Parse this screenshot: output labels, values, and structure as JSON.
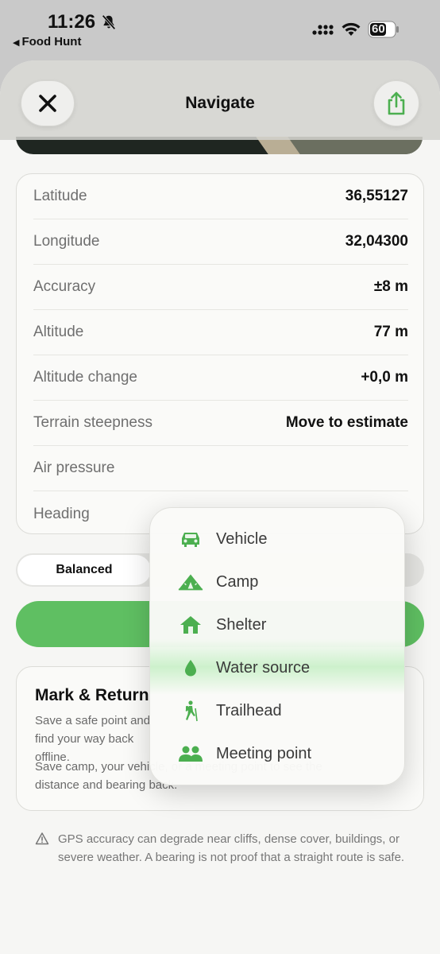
{
  "status_bar": {
    "time": "11:26",
    "back_app": "Food Hunt",
    "battery": "60"
  },
  "header": {
    "title": "Navigate"
  },
  "info": {
    "rows": [
      {
        "label": "Latitude",
        "value": "36,55127"
      },
      {
        "label": "Longitude",
        "value": "32,04300"
      },
      {
        "label": "Accuracy",
        "value": "±8 m"
      },
      {
        "label": "Altitude",
        "value": "77 m"
      },
      {
        "label": "Altitude change",
        "value": "+0,0 m"
      },
      {
        "label": "Terrain steepness",
        "value": "Move to estimate"
      },
      {
        "label": "Air pressure",
        "value": ""
      },
      {
        "label": "Heading",
        "value": ""
      }
    ]
  },
  "segment": {
    "selected_label": "Balanced"
  },
  "mark_card": {
    "title": "Mark & Return",
    "subtitle": "Save a safe point and find your way back offline.",
    "body": "Save camp, your vehicle, or a meeting point to see the distance and bearing back."
  },
  "warning": {
    "text": "GPS accuracy can degrade near cliffs, dense cover, buildings, or severe weather. A bearing is not proof that a straight route is safe."
  },
  "menu": {
    "items": [
      {
        "label": "Vehicle",
        "icon": "car-icon"
      },
      {
        "label": "Camp",
        "icon": "tent-icon"
      },
      {
        "label": "Shelter",
        "icon": "house-icon"
      },
      {
        "label": "Water source",
        "icon": "drop-icon"
      },
      {
        "label": "Trailhead",
        "icon": "hiker-icon"
      },
      {
        "label": "Meeting point",
        "icon": "people-icon"
      }
    ]
  },
  "colors": {
    "accent": "#5fbf62",
    "icon_green": "#4caf50"
  }
}
